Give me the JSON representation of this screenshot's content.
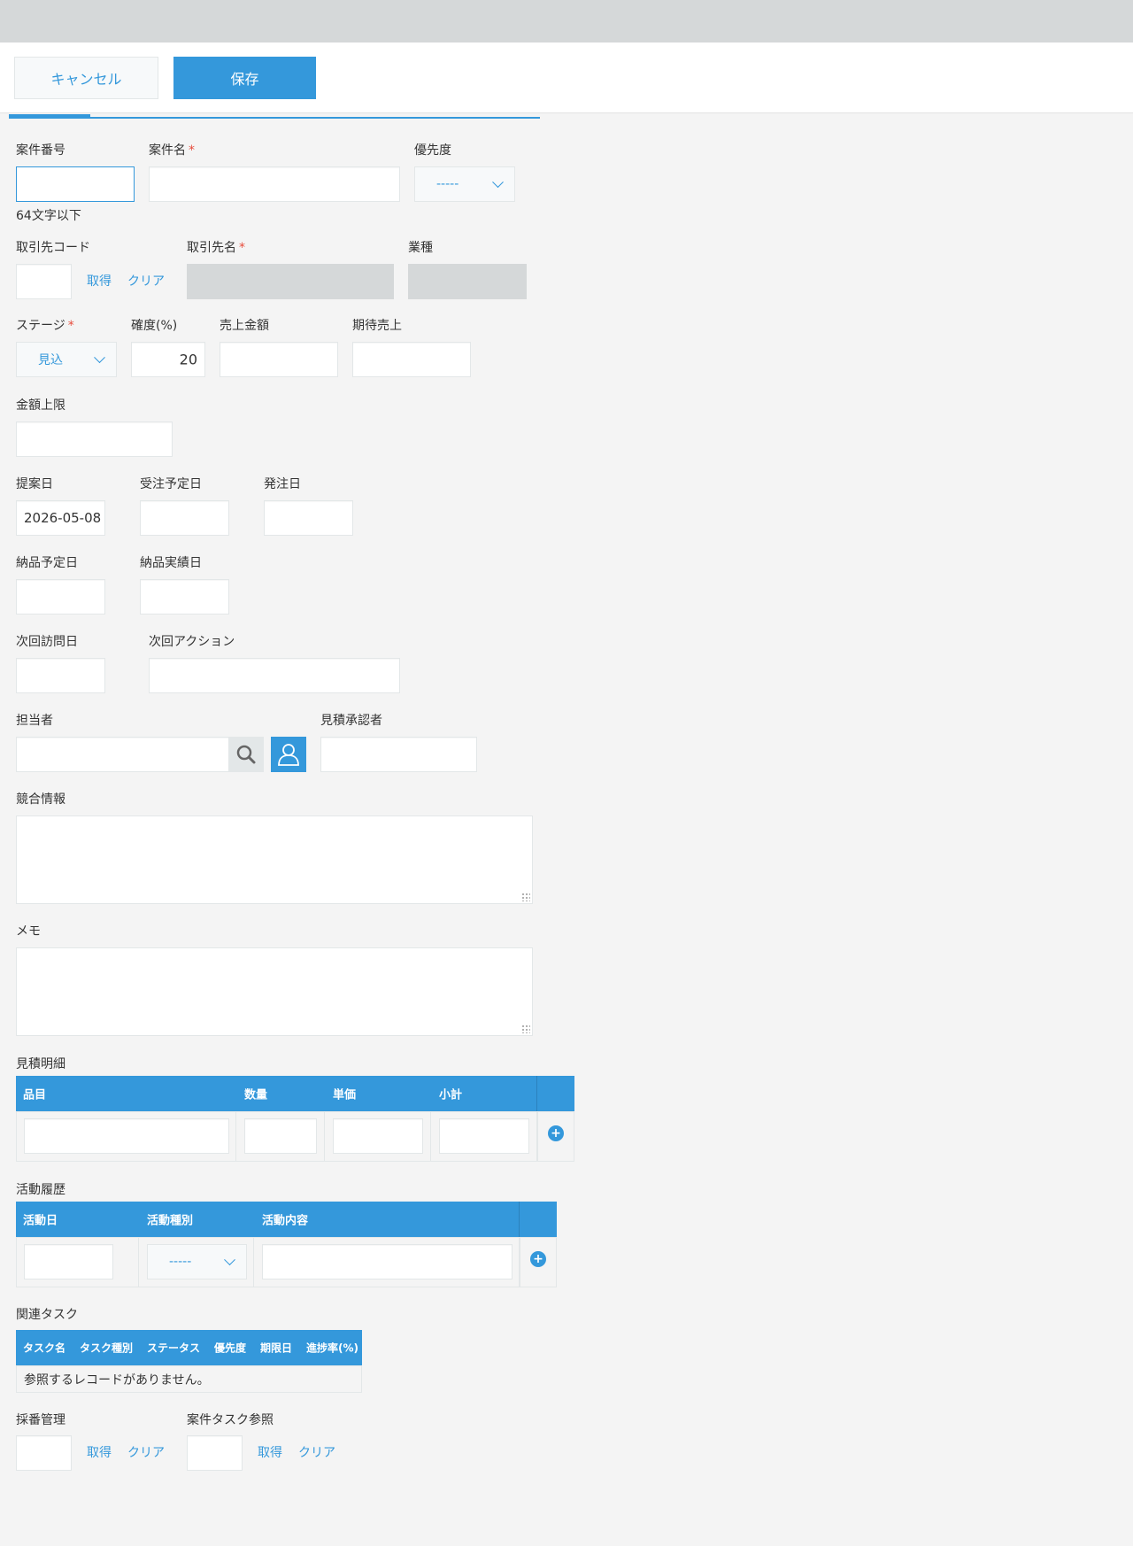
{
  "toolbar": {
    "cancel_label": "キャンセル",
    "save_label": "保存"
  },
  "fields": {
    "case_number": {
      "label": "案件番号",
      "hint": "64文字以下"
    },
    "case_name": {
      "label": "案件名",
      "required": "*"
    },
    "priority": {
      "label": "優先度",
      "value": "-----"
    },
    "client_code": {
      "label": "取引先コード",
      "fetch": "取得",
      "clear": "クリア"
    },
    "client_name": {
      "label": "取引先名",
      "required": "*"
    },
    "industry": {
      "label": "業種"
    },
    "stage": {
      "label": "ステージ",
      "required": "*",
      "value": "見込"
    },
    "probability": {
      "label": "確度(%)",
      "value": "20"
    },
    "sales_amount": {
      "label": "売上金額"
    },
    "expected_sales": {
      "label": "期待売上"
    },
    "amount_limit": {
      "label": "金額上限"
    },
    "proposal_date": {
      "label": "提案日",
      "value": "2026-05-08"
    },
    "order_expected_date": {
      "label": "受注予定日"
    },
    "order_date": {
      "label": "発注日"
    },
    "delivery_expected_date": {
      "label": "納品予定日"
    },
    "delivery_actual_date": {
      "label": "納品実績日"
    },
    "next_visit_date": {
      "label": "次回訪問日"
    },
    "next_action": {
      "label": "次回アクション"
    },
    "assignee": {
      "label": "担当者"
    },
    "estimate_approver": {
      "label": "見積承認者"
    },
    "competition": {
      "label": "競合情報"
    },
    "memo": {
      "label": "メモ"
    }
  },
  "estimate_table": {
    "title": "見積明細",
    "columns": [
      "品目",
      "数量",
      "単価",
      "小計"
    ],
    "add": "+"
  },
  "activity_table": {
    "title": "活動履歴",
    "columns": [
      "活動日",
      "活動種別",
      "活動内容"
    ],
    "type_value": "-----",
    "add": "+"
  },
  "task_table": {
    "title": "関連タスク",
    "columns": [
      "タスク名",
      "タスク種別",
      "ステータス",
      "優先度",
      "期限日",
      "進捗率(%)"
    ],
    "empty": "参照するレコードがありません。"
  },
  "numbering": {
    "label": "採番管理",
    "fetch": "取得",
    "clear": "クリア"
  },
  "case_task_ref": {
    "label": "案件タスク参照",
    "fetch": "取得",
    "clear": "クリア"
  },
  "icons": [
    "search-icon",
    "user-icon",
    "chevron-down-icon",
    "add-row-icon"
  ],
  "colors": {
    "accent": "#3498db",
    "required": "#e74c3c",
    "disabled": "#d5d8d9"
  }
}
